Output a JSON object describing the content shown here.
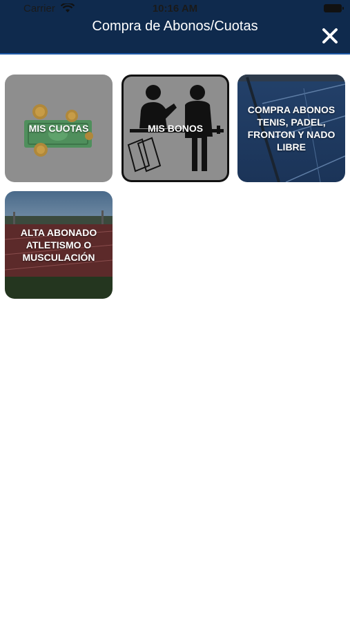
{
  "status_bar": {
    "carrier": "Carrier",
    "time": "10:16 AM",
    "icons": [
      "wifi-icon",
      "battery-icon"
    ]
  },
  "header": {
    "title": "Compra de Abonos/Cuotas",
    "close_icon": "close-icon",
    "background_color": "#0f2a4d"
  },
  "tiles": [
    {
      "label": "MIS CUOTAS",
      "image": "cash-coins-illustration"
    },
    {
      "label": "MIS BONOS",
      "image": "ticket-counter-illustration"
    },
    {
      "label": "COMPRA ABONOS TENIS, PADEL, FRONTON Y NADO LIBRE",
      "image": "tennis-court-photo"
    },
    {
      "label": "ALTA ABONADO ATLETISMO O MUSCULACIÓN",
      "image": "athletics-track-photo"
    }
  ]
}
